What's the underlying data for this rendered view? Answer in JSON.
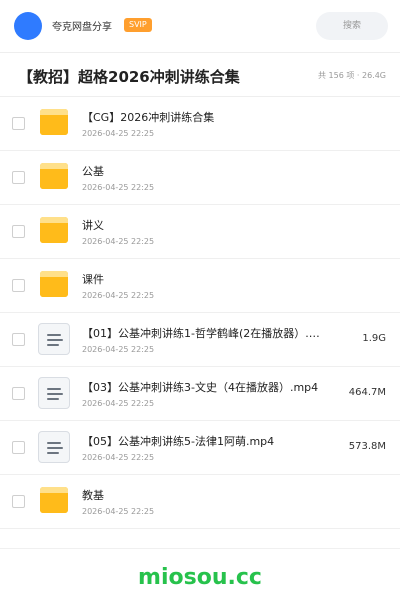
{
  "header": {
    "username": "夸克网盘分享",
    "vip_badge": "SVIP",
    "search_placeholder": "搜索"
  },
  "share": {
    "title": "【教招】超格2026冲刺讲练合集",
    "meta": "共 156 项 · 26.4G"
  },
  "files": [
    {
      "type": "folder",
      "name": "【CG】2026冲刺讲练合集",
      "date": "2026-04-25 22:25",
      "size": ""
    },
    {
      "type": "folder",
      "name": "公基",
      "date": "2026-04-25 22:25",
      "size": ""
    },
    {
      "type": "folder",
      "name": "讲义",
      "date": "2026-04-25 22:25",
      "size": ""
    },
    {
      "type": "folder",
      "name": "课件",
      "date": "2026-04-25 22:25",
      "size": ""
    },
    {
      "type": "file",
      "name": "【01】公基冲刺讲练1-哲学鹤峰(2在播放器）.m···",
      "date": "2026-04-25 22:25",
      "size": "1.9G"
    },
    {
      "type": "file",
      "name": "【03】公基冲刺讲练3-文史（4在播放器）.mp4",
      "date": "2026-04-25 22:25",
      "size": "464.7M"
    },
    {
      "type": "file",
      "name": "【05】公基冲刺讲练5-法律1阿萌.mp4",
      "date": "2026-04-25 22:25",
      "size": "573.8M"
    },
    {
      "type": "folder",
      "name": "教基",
      "date": "2026-04-25 22:25",
      "size": ""
    }
  ],
  "footer": {
    "brand": "miosou.cc",
    "brand_color": "#27c24c"
  },
  "colors": {
    "avatar": "#2f7bff",
    "vip": "#ff9f2e",
    "folder": "#ffc82c"
  }
}
